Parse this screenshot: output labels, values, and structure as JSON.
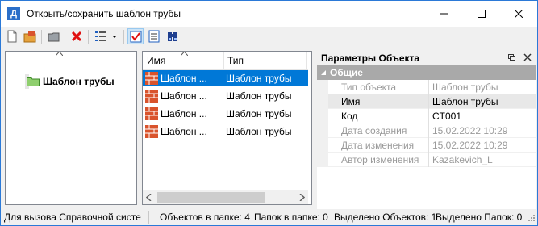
{
  "window": {
    "title": "Открыть/сохранить шаблон трубы",
    "app_icon": "Д"
  },
  "tree": {
    "items": [
      {
        "label": "Шаблон трубы",
        "icon": "folder-icon"
      }
    ]
  },
  "list": {
    "columns": [
      "Имя",
      "Тип"
    ],
    "rows": [
      {
        "name": "Шаблон ...",
        "type": "Шаблон трубы",
        "selected": true
      },
      {
        "name": "Шаблон ...",
        "type": "Шаблон трубы",
        "selected": false
      },
      {
        "name": "Шаблон ...",
        "type": "Шаблон трубы",
        "selected": false
      },
      {
        "name": "Шаблон ...",
        "type": "Шаблон трубы",
        "selected": false
      }
    ]
  },
  "properties": {
    "title": "Параметры Объекта",
    "category": "Общие",
    "rows": [
      {
        "name": "Тип объекта",
        "value": "Шаблон трубы"
      },
      {
        "name": "Имя",
        "value": "Шаблон трубы"
      },
      {
        "name": "Код",
        "value": "CT001"
      },
      {
        "name": "Дата создания",
        "value": "15.02.2022 10:29"
      },
      {
        "name": "Дата изменения",
        "value": "15.02.2022 10:29"
      },
      {
        "name": "Автор изменения",
        "value": "Kazakevich_L"
      }
    ]
  },
  "status": {
    "hint": "Для вызова Справочной систе",
    "objects_in_folder": "Объектов в папке: 4",
    "folders_in_folder": "Папок в папке: 0",
    "selected_objects": "Выделено Объектов: 1",
    "selected_folders": "Выделено Папок: 0"
  },
  "colors": {
    "accent": "#0078d7",
    "brick": "#d9532c",
    "folder": "#8fcf6e"
  }
}
